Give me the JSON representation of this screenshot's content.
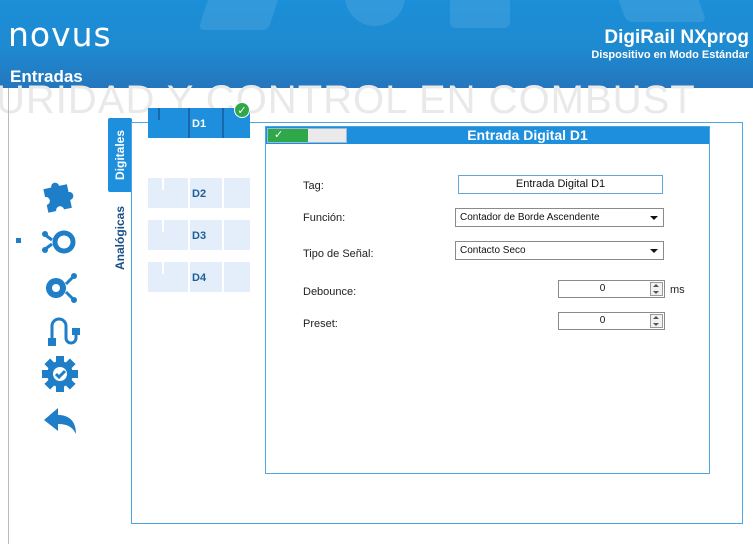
{
  "header": {
    "logo": "novus",
    "page_title": "Entradas",
    "product": "DigiRail NXprog",
    "mode": "Dispositivo en Modo Estándar"
  },
  "watermark": "URIDAD Y CONTROL EN COMBUST",
  "nav": {
    "items": [
      {
        "icon": "puzzle-icon"
      },
      {
        "icon": "input-sensor-icon",
        "selected": true
      },
      {
        "icon": "output-gear-icon"
      },
      {
        "icon": "usb-cable-icon"
      },
      {
        "icon": "gear-check-icon"
      },
      {
        "icon": "back-arrow-icon"
      }
    ]
  },
  "tabs": {
    "digitales": "Digitales",
    "analogicas": "Analógicas"
  },
  "inputs": [
    {
      "label": "D1",
      "active": true,
      "configured": true
    },
    {
      "label": "D2",
      "active": false
    },
    {
      "label": "D3",
      "active": false
    },
    {
      "label": "D4",
      "active": false
    }
  ],
  "check_symbol": "✓",
  "panel": {
    "title": "Entrada Digital D1",
    "toggle_on": "✓",
    "tag_label": "Tag:",
    "tag_value": "Entrada Digital D1",
    "funcion_label": "Función:",
    "funcion_value": "Contador de Borde Ascendente",
    "tipo_label": "Tipo de Señal:",
    "tipo_value": "Contacto Seco",
    "debounce_label": "Debounce:",
    "debounce_value": "0",
    "debounce_unit": "ms",
    "preset_label": "Preset:",
    "preset_value": "0"
  },
  "colors": {
    "header_blue": "#1e8ad0",
    "accent_blue": "#1e8fdc",
    "card_light": "#e4eefa",
    "enabled_green": "#2fa84a"
  }
}
